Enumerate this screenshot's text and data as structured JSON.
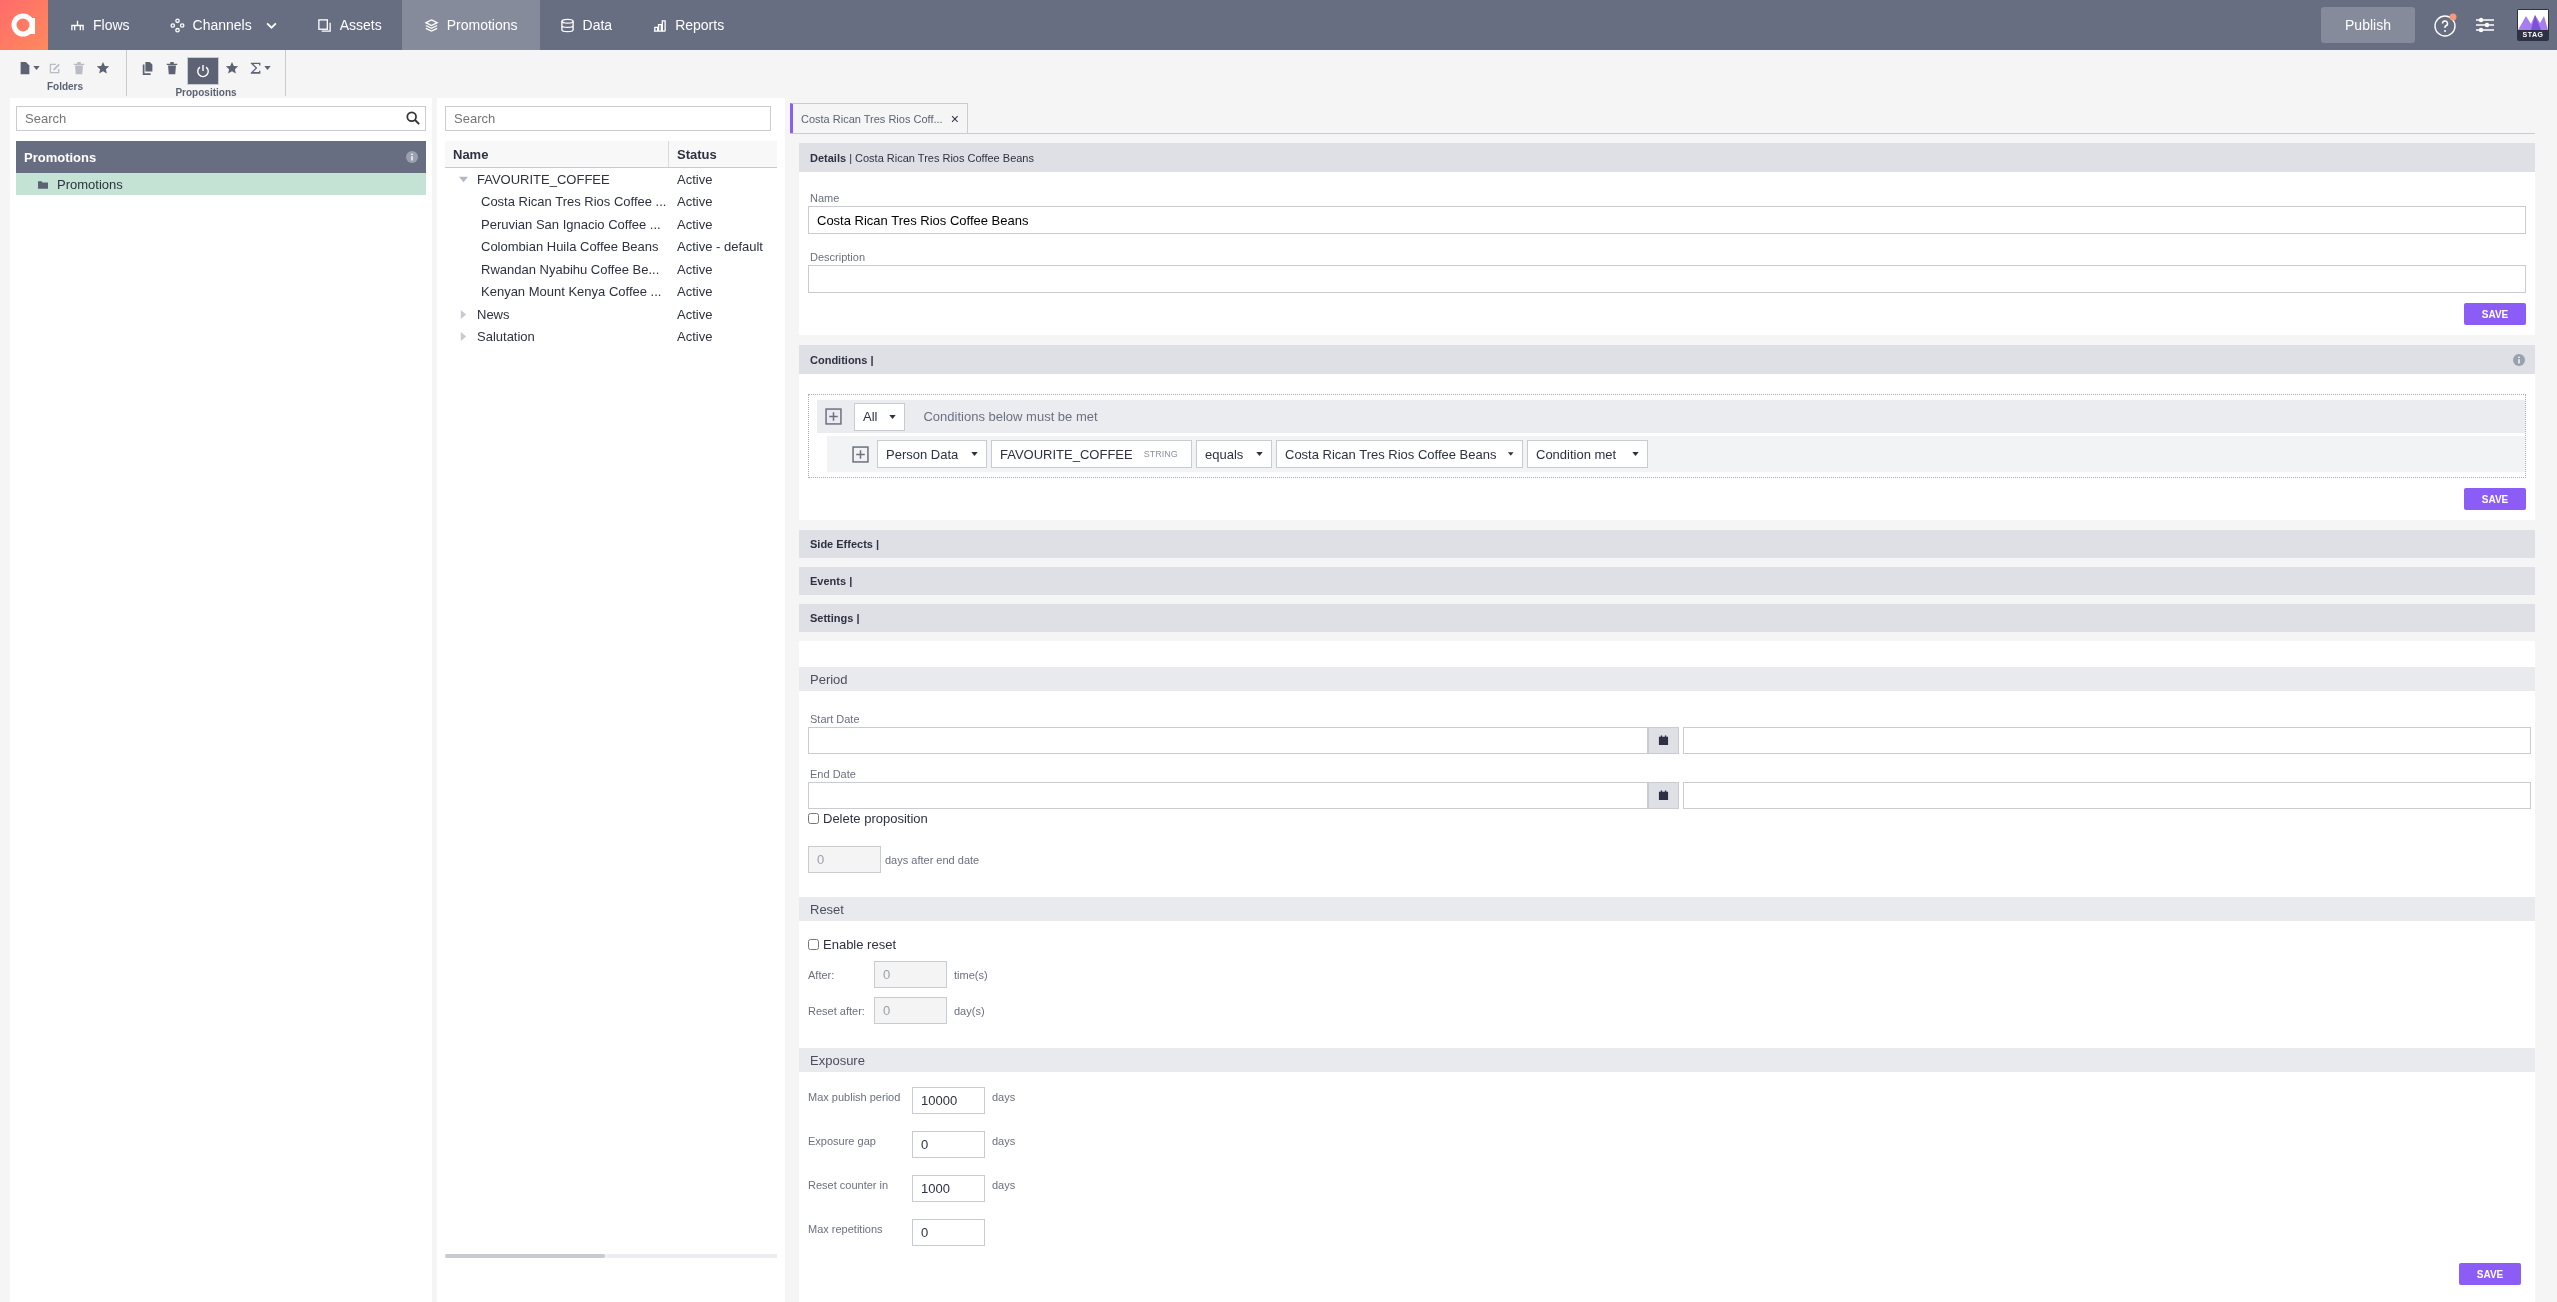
{
  "nav": {
    "items": [
      {
        "label": "Flows",
        "kind": "flows",
        "has_menu": false,
        "selected": false
      },
      {
        "label": "Channels",
        "kind": "channels",
        "has_menu": true,
        "selected": false
      },
      {
        "label": "Assets",
        "kind": "assets",
        "has_menu": false,
        "selected": false
      },
      {
        "label": "Promotions",
        "kind": "layers",
        "has_menu": false,
        "selected": true
      },
      {
        "label": "Data",
        "kind": "database",
        "has_menu": false,
        "selected": false
      },
      {
        "label": "Reports",
        "kind": "chart",
        "has_menu": false,
        "selected": false
      }
    ],
    "publish": "Publish",
    "help_notification": true,
    "env_badge": "STAG"
  },
  "toolbar": [
    {
      "label": "Folders",
      "buttons": [
        {
          "kind": "file",
          "has_menu": true,
          "disabled": false,
          "selected": false
        },
        {
          "kind": "edit",
          "has_menu": false,
          "disabled": true,
          "selected": false
        },
        {
          "kind": "trash",
          "has_menu": false,
          "disabled": true,
          "selected": false
        },
        {
          "kind": "star",
          "has_menu": false,
          "disabled": false,
          "selected": false
        }
      ]
    },
    {
      "label": "Propositions",
      "buttons": [
        {
          "kind": "copy",
          "has_menu": false,
          "disabled": false,
          "selected": false
        },
        {
          "kind": "trash",
          "has_menu": false,
          "disabled": false,
          "selected": false
        },
        {
          "kind": "power",
          "has_menu": false,
          "disabled": false,
          "selected": true
        },
        {
          "kind": "star",
          "has_menu": false,
          "disabled": false,
          "selected": false
        },
        {
          "kind": "sigma",
          "has_menu": true,
          "disabled": false,
          "selected": false
        }
      ]
    }
  ],
  "folders": {
    "search": {
      "placeholder": "Search"
    },
    "header": "Promotions",
    "items": [
      {
        "label": "Promotions",
        "selected": true
      }
    ]
  },
  "propositions": {
    "search": {
      "placeholder": "Search"
    },
    "columns": [
      "Name",
      "Status"
    ],
    "rows": [
      {
        "name": "FAVOURITE_COFFEE",
        "status": "Active",
        "expanded": true,
        "children": [
          {
            "name": "Costa Rican Tres Rios Coffee ...",
            "status": "Active"
          },
          {
            "name": "Peruvian San Ignacio Coffee ...",
            "status": "Active"
          },
          {
            "name": "Colombian Huila Coffee Beans",
            "status": "Active - default"
          },
          {
            "name": "Rwandan Nyabihu Coffee Be...",
            "status": "Active"
          },
          {
            "name": "Kenyan Mount Kenya Coffee ...",
            "status": "Active"
          }
        ]
      },
      {
        "name": "News",
        "status": "Active",
        "expanded": false
      },
      {
        "name": "Salutation",
        "status": "Active",
        "expanded": false
      }
    ]
  },
  "editor": {
    "tab": {
      "title": "Costa Rican Tres Rios Coff...",
      "close": "×"
    },
    "details": {
      "title": "**Details** | Costa Rican Tres Rios Coffee Beans",
      "name_label": "Name",
      "name_value": "Costa Rican Tres Rios Coffee Beans",
      "description_label": "Description",
      "save": "SAVE"
    },
    "conditions": {
      "title": "Conditions |",
      "group_operator": "All",
      "group_text": "Conditions below must be met",
      "rule": {
        "source": "Person Data",
        "field": "FAVOURITE_COFFEE",
        "field_type": "STRING",
        "operator": "equals",
        "value": "Costa Rican Tres Rios Coffee Beans",
        "result": "Condition met"
      },
      "save": "SAVE"
    },
    "collapsed_sections": [
      "Side Effects |",
      "Events |",
      "Settings |"
    ],
    "period": {
      "title": "Period",
      "start_label": "Start Date",
      "end_label": "End Date",
      "delete_label": "Delete proposition",
      "delete_checked": false,
      "days_value": "0",
      "days_disabled": true,
      "days_unit": "days after end date"
    },
    "reset": {
      "title": "Reset",
      "enable_label": "Enable reset",
      "enable_checked": false,
      "rows": [
        {
          "label": "After:",
          "value": "0",
          "unit": "time(s)",
          "disabled": true
        },
        {
          "label": "Reset after:",
          "value": "0",
          "unit": "day(s)",
          "disabled": true
        }
      ]
    },
    "exposure": {
      "title": "Exposure",
      "rows": [
        {
          "label": "Max publish period",
          "value": "10000",
          "unit": "days"
        },
        {
          "label": "Exposure gap",
          "value": "0",
          "unit": "days"
        },
        {
          "label": "Reset counter in",
          "value": "1000",
          "unit": "days"
        },
        {
          "label": "Max repetitions",
          "value": "0"
        }
      ],
      "save": "SAVE"
    }
  }
}
